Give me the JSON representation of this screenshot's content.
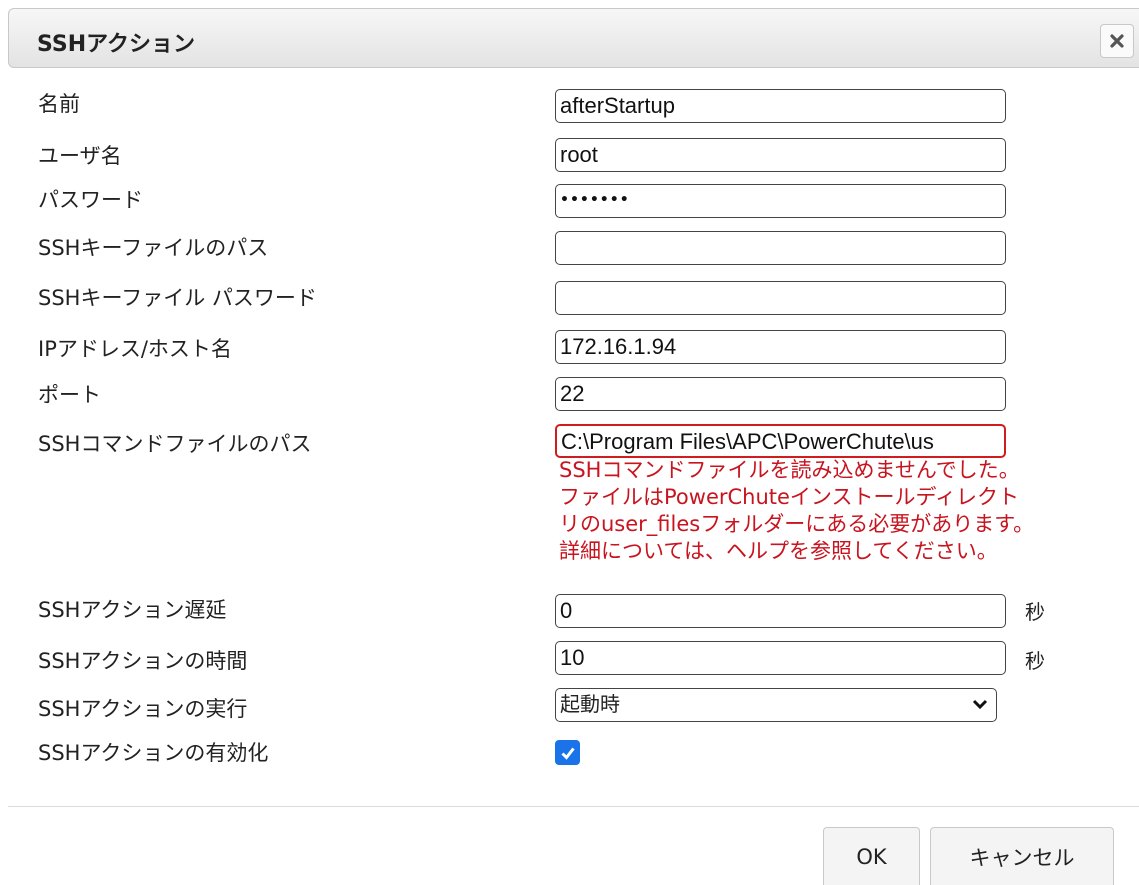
{
  "dialog": {
    "title": "SSHアクション"
  },
  "form": {
    "labels": {
      "name": "名前",
      "username": "ユーザ名",
      "password": "パスワード",
      "ssh_key_path": "SSHキーファイルのパス",
      "ssh_key_password": "SSHキーファイル パスワード",
      "ip_host": "IPアドレス/ホスト名",
      "port": "ポート",
      "command_file_path": "SSHコマンドファイルのパス",
      "action_delay": "SSHアクション遅延",
      "action_duration": "SSHアクションの時間",
      "action_run": "SSHアクションの実行",
      "action_enable": "SSHアクションの有効化"
    },
    "values": {
      "name": "afterStartup",
      "username": "root",
      "password": "•••••••",
      "ssh_key_path": "",
      "ssh_key_password": "",
      "ip_host": "172.16.1.94",
      "port": "22",
      "command_file_path": "C:\\Program Files\\APC\\PowerChute\\us",
      "action_delay": "0",
      "action_duration": "10",
      "action_run": "起動時",
      "action_enable": true
    },
    "error_lines": [
      "SSHコマンドファイルを読み込めませんでした。",
      "ファイルはPowerChuteインストールディレクト",
      "リのuser_filesフォルダーにある必要があります。",
      "詳細については、ヘルプを参照してください。"
    ],
    "unit_seconds": "秒"
  },
  "buttons": {
    "ok": "OK",
    "cancel": "キャンセル"
  },
  "colors": {
    "error": "#c8141e",
    "checkbox": "#1a73e8"
  },
  "icons": {
    "close": "close-icon",
    "dropdown": "chevron-down-icon",
    "check": "checkmark-icon"
  }
}
